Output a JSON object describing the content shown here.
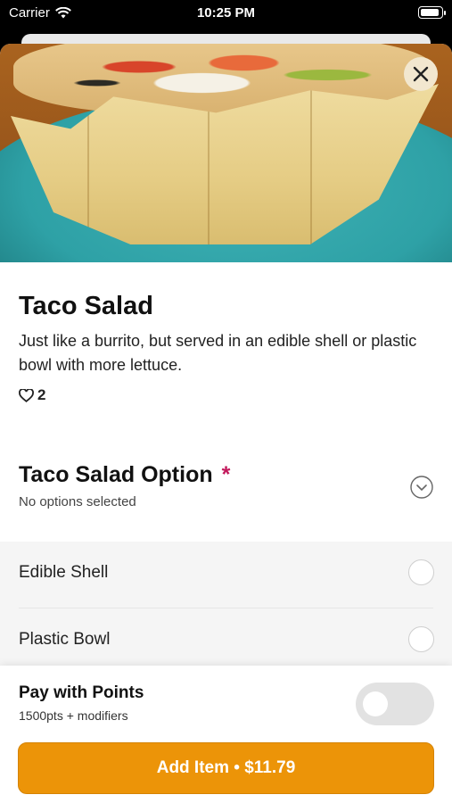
{
  "status_bar": {
    "carrier": "Carrier",
    "time": "10:25 PM"
  },
  "item": {
    "title": "Taco Salad",
    "description": "Just like a burrito, but served in an edible shell or plastic bowl with more lettuce.",
    "likes": "2",
    "image_icon": "taco-salad-photo"
  },
  "option_group": {
    "title": "Taco Salad Option",
    "required_mark": "*",
    "subtitle": "No options selected",
    "choices": [
      {
        "label": "Edible Shell"
      },
      {
        "label": "Plastic Bowl"
      }
    ]
  },
  "points": {
    "label": "Pay with Points",
    "sublabel": "1500pts + modifiers",
    "enabled": false
  },
  "cta": {
    "label": "Add Item • $11.79"
  },
  "colors": {
    "accent": "#ec9408",
    "required": "#c2185b",
    "close_bg": "#f2e7cf"
  }
}
